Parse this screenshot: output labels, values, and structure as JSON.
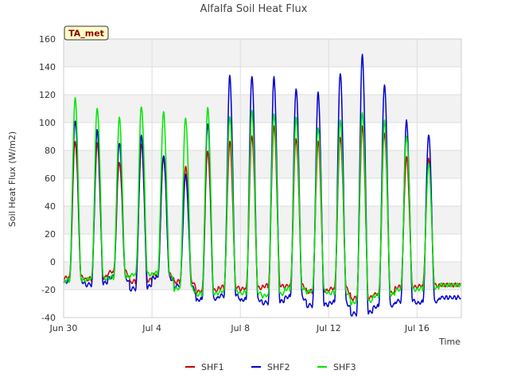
{
  "chart_data": {
    "type": "line",
    "title": "Alfalfa Soil Heat Flux",
    "xlabel": "Time",
    "ylabel": "Soil Heat Flux (W/m2)",
    "badge": "TA_met",
    "ylim": [
      -40,
      160
    ],
    "yticks": [
      -40,
      -20,
      0,
      20,
      40,
      60,
      80,
      100,
      120,
      140,
      160
    ],
    "xlim": [
      "2023-06-30T00:00",
      "2023-07-18T00:00"
    ],
    "xticks": [
      {
        "date": "2023-06-30T00:00",
        "label": "Jun 30"
      },
      {
        "date": "2023-07-04T00:00",
        "label": "Jul 4"
      },
      {
        "date": "2023-07-08T00:00",
        "label": "Jul 8"
      },
      {
        "date": "2023-07-12T00:00",
        "label": "Jul 12"
      },
      {
        "date": "2023-07-16T00:00",
        "label": "Jul 16"
      }
    ],
    "grid": true,
    "legend_position": "bottom",
    "daily_peak_hour": 12.5,
    "days": [
      "2023-06-30",
      "2023-07-01",
      "2023-07-02",
      "2023-07-03",
      "2023-07-04",
      "2023-07-05",
      "2023-07-06",
      "2023-07-07",
      "2023-07-08",
      "2023-07-09",
      "2023-07-10",
      "2023-07-11",
      "2023-07-12",
      "2023-07-13",
      "2023-07-14",
      "2023-07-15",
      "2023-07-16",
      "2023-07-17"
    ],
    "series": [
      {
        "name": "SHF1",
        "color": "#cc0000",
        "daily_max": [
          87,
          85,
          72,
          84,
          75,
          68,
          80,
          86,
          91,
          97,
          89,
          86,
          90,
          97,
          93,
          75,
          75,
          null
        ],
        "daily_min": [
          -12,
          -13,
          -8,
          -15,
          -10,
          -15,
          -22,
          -19,
          -20,
          -18,
          -18,
          -22,
          -20,
          -27,
          -24,
          -19,
          -18,
          -17
        ]
      },
      {
        "name": "SHF2",
        "color": "#0000cc",
        "daily_max": [
          102,
          94,
          86,
          90,
          77,
          62,
          100,
          133,
          134,
          132,
          125,
          121,
          136,
          148,
          128,
          101,
          92,
          null
        ],
        "daily_min": [
          -15,
          -17,
          -12,
          -20,
          -12,
          -18,
          -28,
          -25,
          -28,
          -30,
          -26,
          -32,
          -30,
          -38,
          -33,
          -29,
          -30,
          -26
        ]
      },
      {
        "name": "SHF3",
        "color": "#00e600",
        "daily_max": [
          117,
          111,
          103,
          112,
          107,
          104,
          110,
          105,
          108,
          107,
          103,
          97,
          101,
          108,
          101,
          91,
          70,
          null
        ],
        "daily_min": [
          -14,
          -13,
          -12,
          -10,
          -9,
          -20,
          -24,
          -22,
          -23,
          -25,
          -20,
          -22,
          -23,
          -30,
          -25,
          -21,
          -20,
          -17
        ]
      }
    ]
  }
}
